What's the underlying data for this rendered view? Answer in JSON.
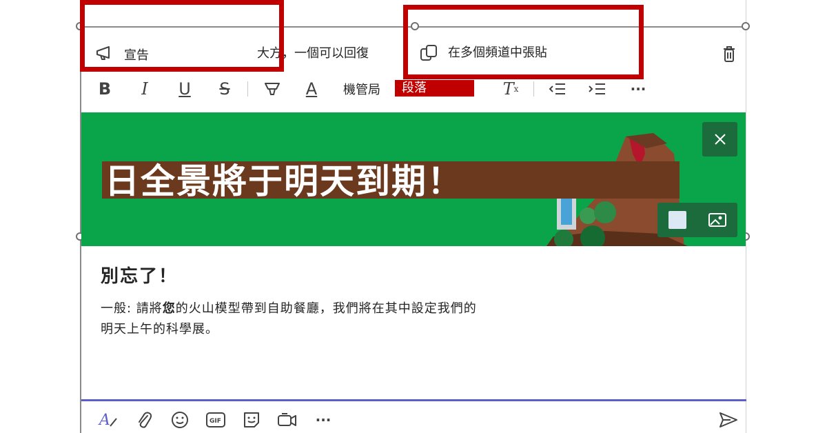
{
  "header": {
    "post_type_label": "宣告",
    "reply_option_label": "大方，一個可以回復",
    "crosspost_label": "在多個頻道中張貼",
    "delete_icon": "trash-icon"
  },
  "format_toolbar": {
    "buttons": [
      "bold-icon",
      "italic-icon",
      "underline-icon",
      "strikethrough-icon",
      "highlight-icon",
      "font-color-icon"
    ],
    "font_size_label": "機管局",
    "paragraph_label": "段落",
    "clear_format_icon": "clear-formatting-icon",
    "more_icon": "more-icon"
  },
  "banner": {
    "headline": "日全景將于明天到期！",
    "background_color": "#0aa44b",
    "headline_bg_color": "#6b3a1e"
  },
  "message": {
    "subject": "別忘了！",
    "body_prefix": "一般: 請將",
    "body_bold": "您",
    "body_line1_rest": "的火山模型帶到自助餐廳，我們將在其中設定我們的",
    "body_line2": "明天上午的科學展。"
  },
  "compose_toolbar": {
    "icons": [
      "format-icon",
      "attach-icon",
      "emoji-icon",
      "gif-icon",
      "sticker-icon",
      "meet-now-icon",
      "more-options-icon"
    ],
    "send_icon": "send-icon",
    "accent_color": "#5b5fc7"
  },
  "annotation_color": "#c00000"
}
